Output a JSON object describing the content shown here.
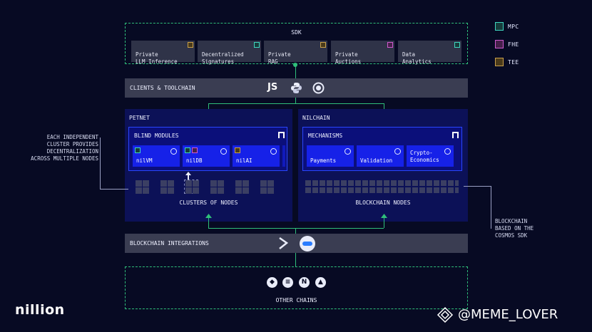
{
  "legend": [
    {
      "label": "MPC",
      "color": "#3fd6c0"
    },
    {
      "label": "FHE",
      "color": "#d05bd0"
    },
    {
      "label": "TEE",
      "color": "#c9a04a"
    }
  ],
  "sdk": {
    "title": "SDK",
    "cards": [
      {
        "label": "Private\nLLM Inference",
        "tag": "TEE"
      },
      {
        "label": "Decentralized\nSignatures",
        "tag": "MPC"
      },
      {
        "label": "Private\nRAG",
        "tag": "TEE"
      },
      {
        "label": "Private\nAuctions",
        "tag": "FHE"
      },
      {
        "label": "Data\nAnalytics",
        "tag": "MPC"
      }
    ]
  },
  "clients": {
    "label": "CLIENTS & TOOLCHAIN",
    "icons": [
      "JS",
      "python-icon",
      "rust-icon"
    ],
    "js_text": "JS"
  },
  "petnet": {
    "title": "PETNET",
    "blind_modules": {
      "title": "BLIND MODULES",
      "modules": [
        {
          "name": "nilVM"
        },
        {
          "name": "nilDB"
        },
        {
          "name": "nilAI"
        }
      ]
    },
    "clusters_label": "CLUSTERS OF NODES"
  },
  "nilchain": {
    "title": "NILCHAIN",
    "mechanisms": {
      "title": "MECHANISMS",
      "items": [
        {
          "name": "Payments"
        },
        {
          "name": "Validation"
        },
        {
          "name": "Crypto-\nEconomics"
        }
      ]
    },
    "nodes_label": "BLOCKCHAIN NODES"
  },
  "annotations": {
    "left": "EACH INDEPENDENT\nCLUSTER PROVIDES\nDECENTRALIZATION\nACROSS MULTIPLE NODES",
    "right": "BLOCKCHAIN\nBASED ON THE\nCOSMOS SDK"
  },
  "integrations": {
    "label": "BLOCKCHAIN INTEGRATIONS"
  },
  "other_chains": {
    "label": "OTHER CHAINS",
    "icons": [
      "ethereum-icon",
      "solana-icon",
      "near-icon",
      "arbitrum-icon"
    ]
  },
  "brand": {
    "logo": "nillion"
  },
  "watermark": {
    "text": "@MEME_LOVER"
  }
}
